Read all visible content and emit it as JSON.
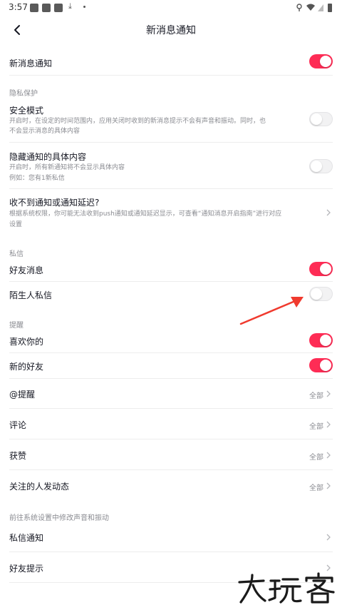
{
  "status_bar": {
    "time": "3:57"
  },
  "header": {
    "title": "新消息通知"
  },
  "main_toggle": {
    "label": "新消息通知",
    "on": true
  },
  "privacy": {
    "section": "隐私保护",
    "safe_mode": {
      "label": "安全模式",
      "desc_line1": "开启时，在设定的时间范围内，应用关闭时收到的新消息提示不会有声音和振动。同时，也",
      "desc_line2": "不会显示消息的具体内容",
      "on": false
    },
    "hide_content": {
      "label": "隐藏通知的具体内容",
      "desc_line1": "开启时，所有新通知将不会显示具体内容",
      "desc_line2": "例如：您有1新私信",
      "on": false
    },
    "delay": {
      "label": "收不到通知或通知延迟?",
      "desc_line1": "根据系统权限，你可能无法收到push通知或通知延迟显示，可查看“通知消息开启指南”进行对应",
      "desc_line2": "设置"
    }
  },
  "dm": {
    "section": "私信",
    "friend_msg": {
      "label": "好友消息",
      "on": true
    },
    "stranger_msg": {
      "label": "陌生人私信",
      "on": false
    }
  },
  "remind": {
    "section": "提醒",
    "likes_you": {
      "label": "喜欢你的",
      "on": true
    },
    "new_friend": {
      "label": "新的好友",
      "on": true
    },
    "mention": {
      "label": "@提醒",
      "value": "全部"
    },
    "comment": {
      "label": "评论",
      "value": "全部"
    },
    "praise": {
      "label": "获赞",
      "value": "全部"
    },
    "following": {
      "label": "关注的人发动态",
      "value": "全部"
    }
  },
  "system": {
    "section": "前往系统设置中修改声音和振动",
    "dm_notify": {
      "label": "私信通知"
    },
    "friend_tip": {
      "label": "好友提示"
    }
  },
  "watermark": {
    "text": "大玩客"
  },
  "colors": {
    "accent": "#fe2c55",
    "annotation": "#f03a2e"
  }
}
